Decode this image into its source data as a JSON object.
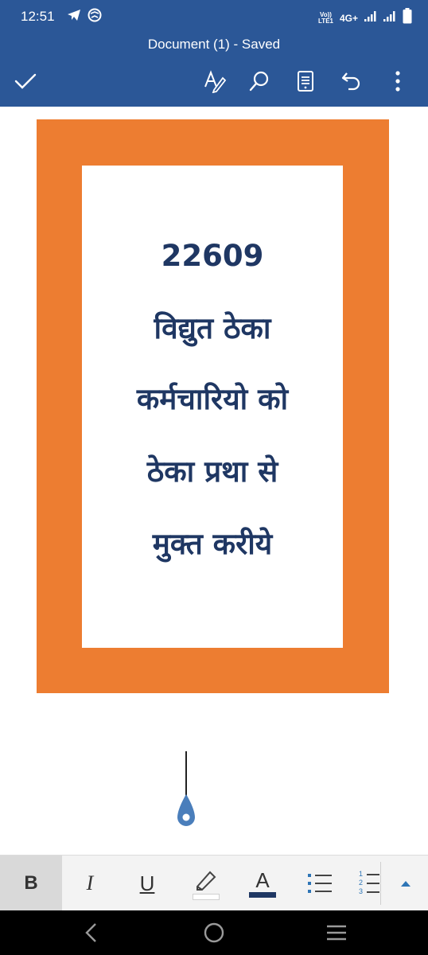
{
  "status_bar": {
    "time": "12:51",
    "network_label": "4G+",
    "volte_line1": "Vo))",
    "volte_line2": "LTE1"
  },
  "header": {
    "title": "Document (1) - Saved",
    "icons": [
      "check-icon",
      "pen-a-icon",
      "search-icon",
      "reading-view-icon",
      "undo-icon",
      "more-vertical-icon"
    ]
  },
  "document": {
    "lines": [
      "22609",
      "विद्युत ठेका",
      "कर्मचारियो को",
      "ठेका प्रथा से",
      "मुक्त करीये"
    ],
    "border_color": "#ed7d31",
    "text_color": "#1f3763"
  },
  "format_toolbar": {
    "bold_label": "B",
    "italic_label": "I",
    "underline_label": "U",
    "font_color_label": "A",
    "numbered_list_digits": [
      "1",
      "2",
      "3"
    ],
    "highlight_color": "#ffffff",
    "font_color": "#1f3763"
  },
  "theme": {
    "header_color": "#2b5797"
  }
}
